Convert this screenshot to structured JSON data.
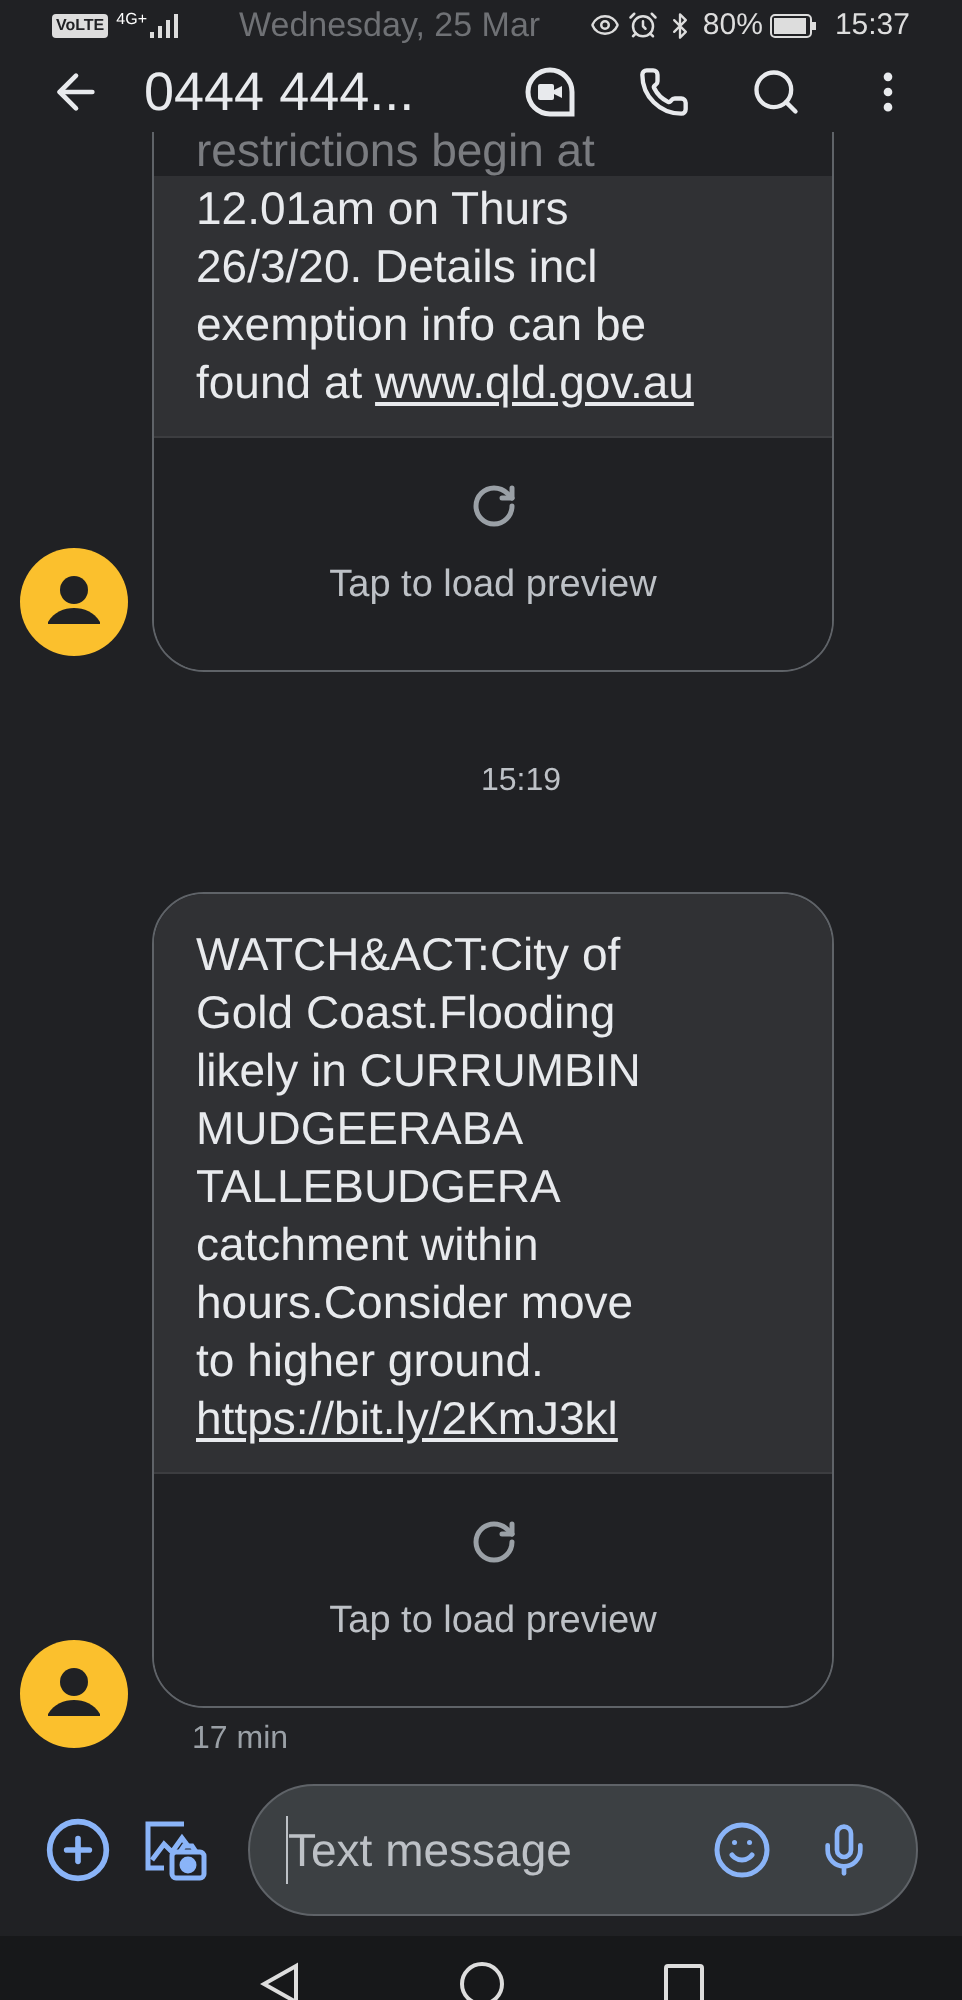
{
  "status_bar": {
    "volte": "VoLTE",
    "network": "4G+",
    "faded_date": "Wednesday, 25 Mar",
    "battery": "80%",
    "time": "15:37"
  },
  "header": {
    "contact": "0444 444..."
  },
  "messages": [
    {
      "kind": "bubble",
      "faded_line": "restrictions begin at",
      "lines": [
        "12.01am on Thurs",
        "26/3/20. Details incl",
        "exemption info can be",
        "found at"
      ],
      "link": "www.qld.gov.au",
      "preview": "Tap to load preview"
    },
    {
      "kind": "timestamp",
      "text": "15:19"
    },
    {
      "kind": "bubble",
      "lines": [
        "WATCH&ACT:City of",
        "Gold Coast.Flooding",
        "likely in CURRUMBIN",
        "MUDGEERABA",
        "TALLEBUDGERA",
        "catchment within",
        "hours.Consider move",
        "to higher ground."
      ],
      "link": "https://bit.ly/2KmJ3kl",
      "preview": "Tap to load preview",
      "meta": "17 min"
    }
  ],
  "composer": {
    "placeholder": "Text message"
  }
}
